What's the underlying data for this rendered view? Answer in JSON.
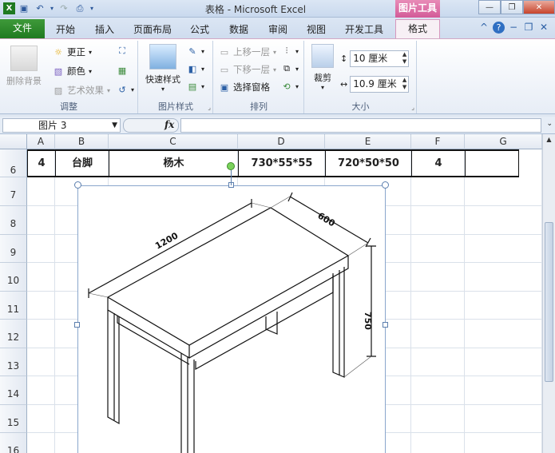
{
  "titlebar": {
    "title": "表格 - Microsoft Excel",
    "context_tab": "图片工具"
  },
  "tabs": {
    "file": "文件",
    "items": [
      "开始",
      "插入",
      "页面布局",
      "公式",
      "数据",
      "审阅",
      "视图",
      "开发工具"
    ],
    "format": "格式"
  },
  "ribbon": {
    "adjust": {
      "label": "调整",
      "remove_bg": "删除背景",
      "correct": "更正",
      "color": "颜色",
      "artistic": "艺术效果"
    },
    "styles": {
      "label": "图片样式",
      "quick_styles": "快速样式"
    },
    "arrange": {
      "label": "排列",
      "bring_forward": "上移一层",
      "send_backward": "下移一层",
      "selection_pane": "选择窗格"
    },
    "size": {
      "label": "大小",
      "crop": "裁剪",
      "height": "10 厘米",
      "width": "10.9 厘米"
    }
  },
  "formula_bar": {
    "name_box": "图片 3",
    "fx": "fx"
  },
  "grid": {
    "columns": [
      "A",
      "B",
      "C",
      "D",
      "E",
      "F",
      "G"
    ],
    "rows": [
      "6",
      "7",
      "8",
      "9",
      "10",
      "11",
      "12",
      "13",
      "14",
      "15",
      "16"
    ],
    "row6": [
      "4",
      "台脚",
      "杨木",
      "730*55*55",
      "720*50*50",
      "4",
      ""
    ]
  },
  "drawing": {
    "length": "1200",
    "depth": "600",
    "height": "750"
  }
}
